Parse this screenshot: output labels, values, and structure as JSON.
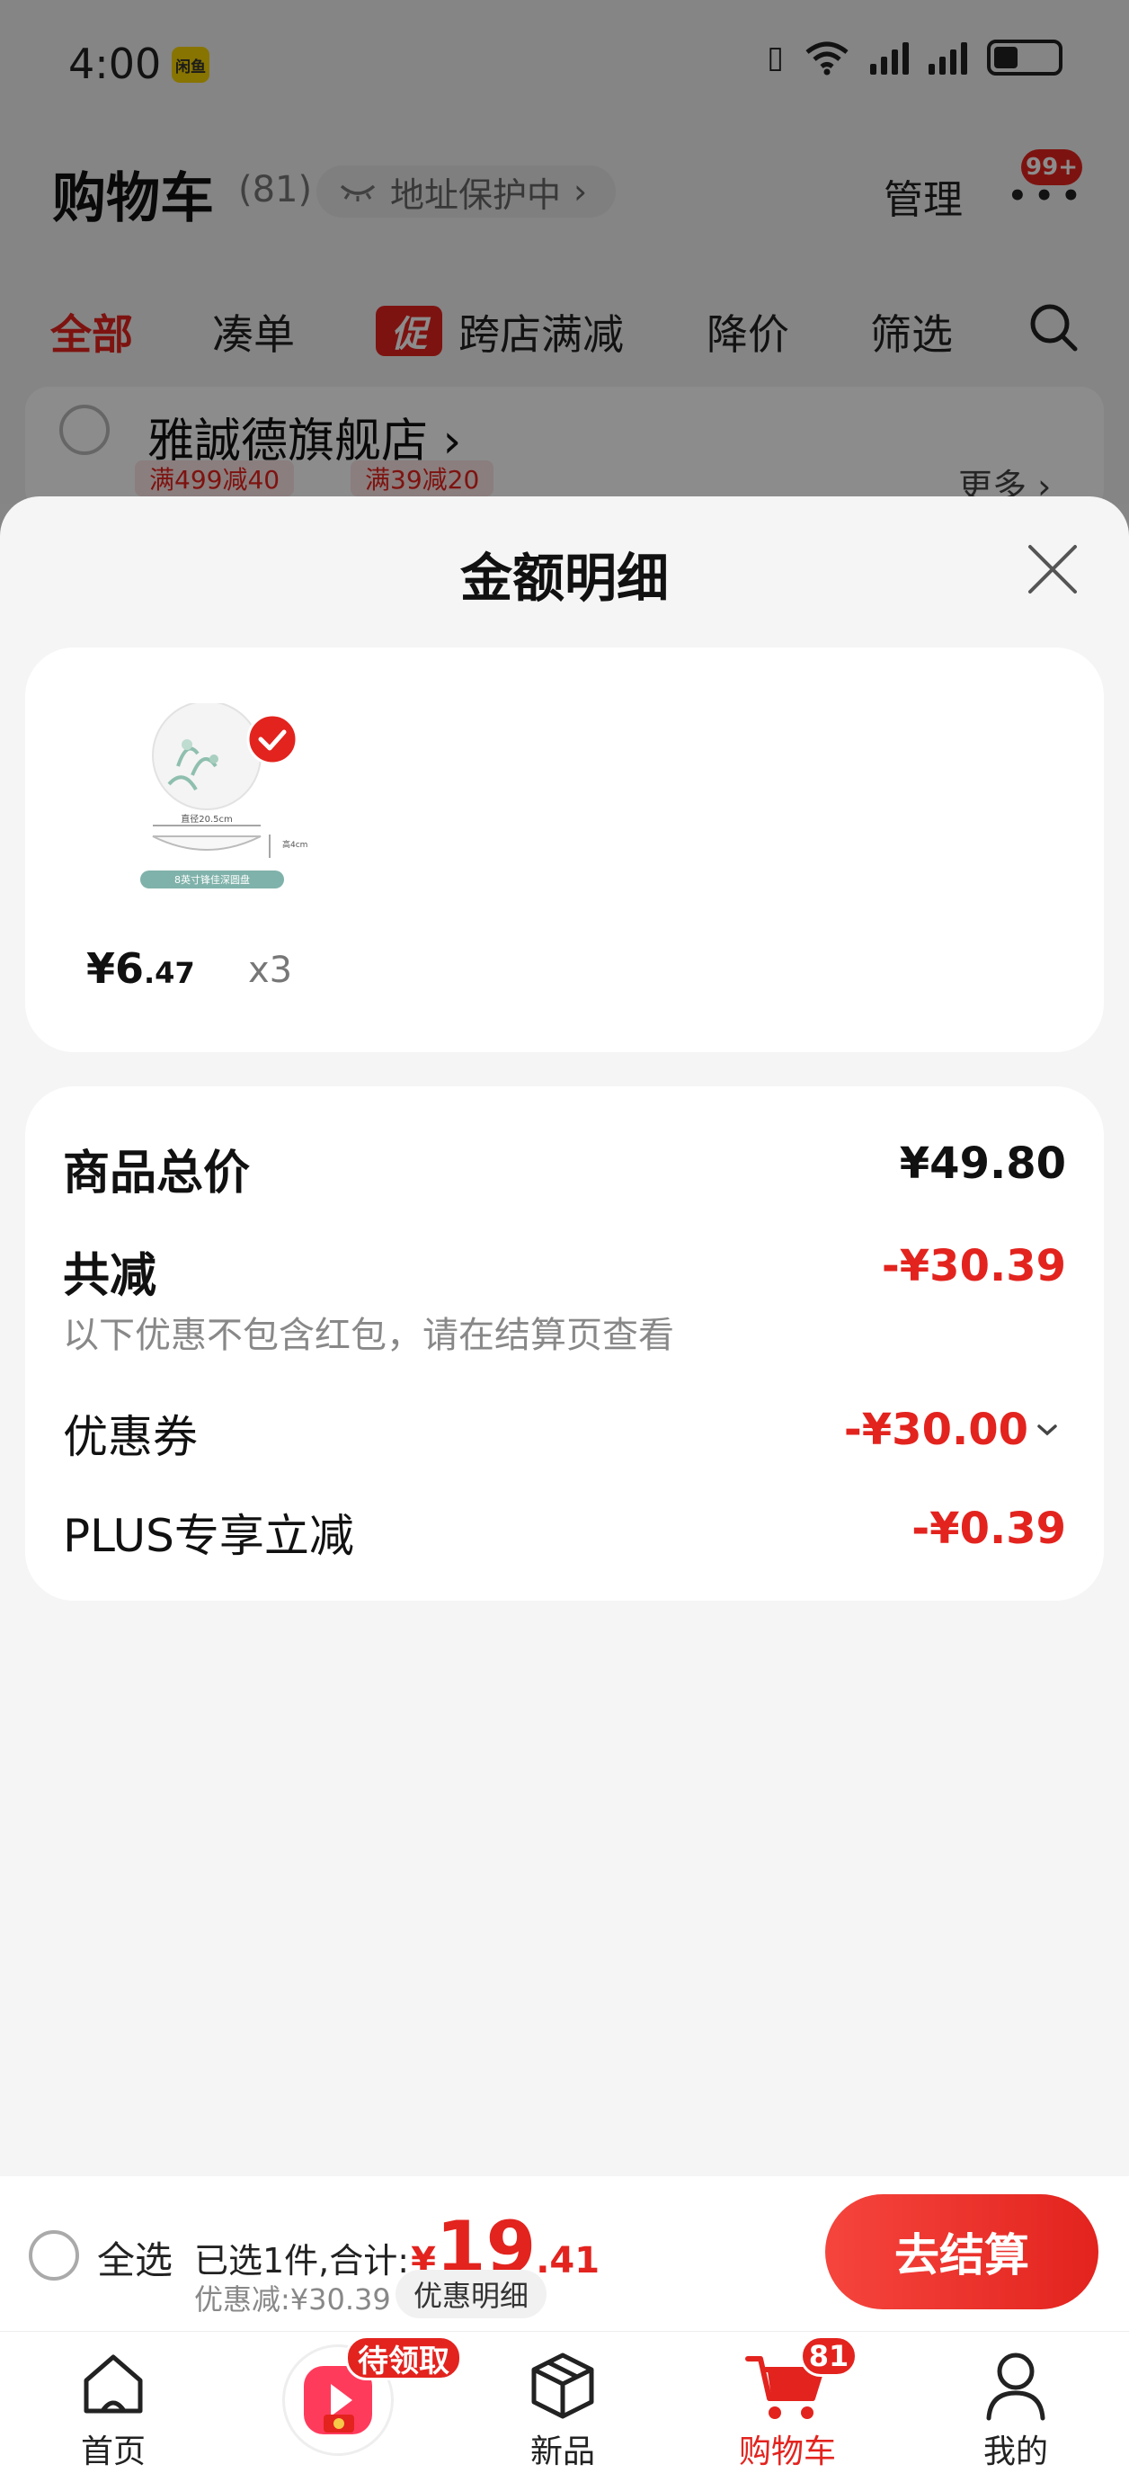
{
  "status_bar": {
    "time": "4:00",
    "app_badge": "闲鱼"
  },
  "header": {
    "title": "购物车",
    "count": "(81)",
    "address_pill": "地址保护中",
    "manage": "管理",
    "more_badge": "99+"
  },
  "filter_tabs": [
    {
      "label": "全部",
      "active": true
    },
    {
      "label": "凑单",
      "active": false
    },
    {
      "label": "跨店满减",
      "tag": "促",
      "active": false
    },
    {
      "label": "降价",
      "active": false
    },
    {
      "label": "筛选",
      "active": false
    }
  ],
  "store": {
    "name": "雅誠德旗舰店",
    "coupons": [
      "满499减40",
      "满39减20"
    ],
    "more": "更多"
  },
  "sheet": {
    "title": "金额明细",
    "item": {
      "price_int": "¥6",
      "price_dec": ".47",
      "qty": "x3",
      "image_caption": "8英寸锋佳深圆盘",
      "image_dim_1": "直径20.5cm",
      "image_dim_2": "高4cm"
    },
    "rows": {
      "total_label": "商品总价",
      "total_value": "¥49.80",
      "discount_label": "共减",
      "discount_value": "-¥30.39",
      "discount_note": "以下优惠不包含红包，请在结算页查看",
      "coupon_label": "优惠券",
      "coupon_value": "-¥30.00",
      "plus_label": "PLUS专享立减",
      "plus_value": "-¥0.39"
    }
  },
  "checkout": {
    "select_all": "全选",
    "selected_text": "已选1件,合计:",
    "yen": "¥",
    "total_int": "19",
    "total_dec": ".41",
    "saved_text": "优惠减:¥30.39",
    "detail_button": "优惠明细",
    "checkout_button": "去结算"
  },
  "tabbar": {
    "home": "首页",
    "pending_badge": "待领取",
    "new": "新品",
    "cart": "购物车",
    "cart_badge": "81",
    "me": "我的"
  },
  "colors": {
    "accent": "#e3231e",
    "background": "#f5f5f5"
  }
}
